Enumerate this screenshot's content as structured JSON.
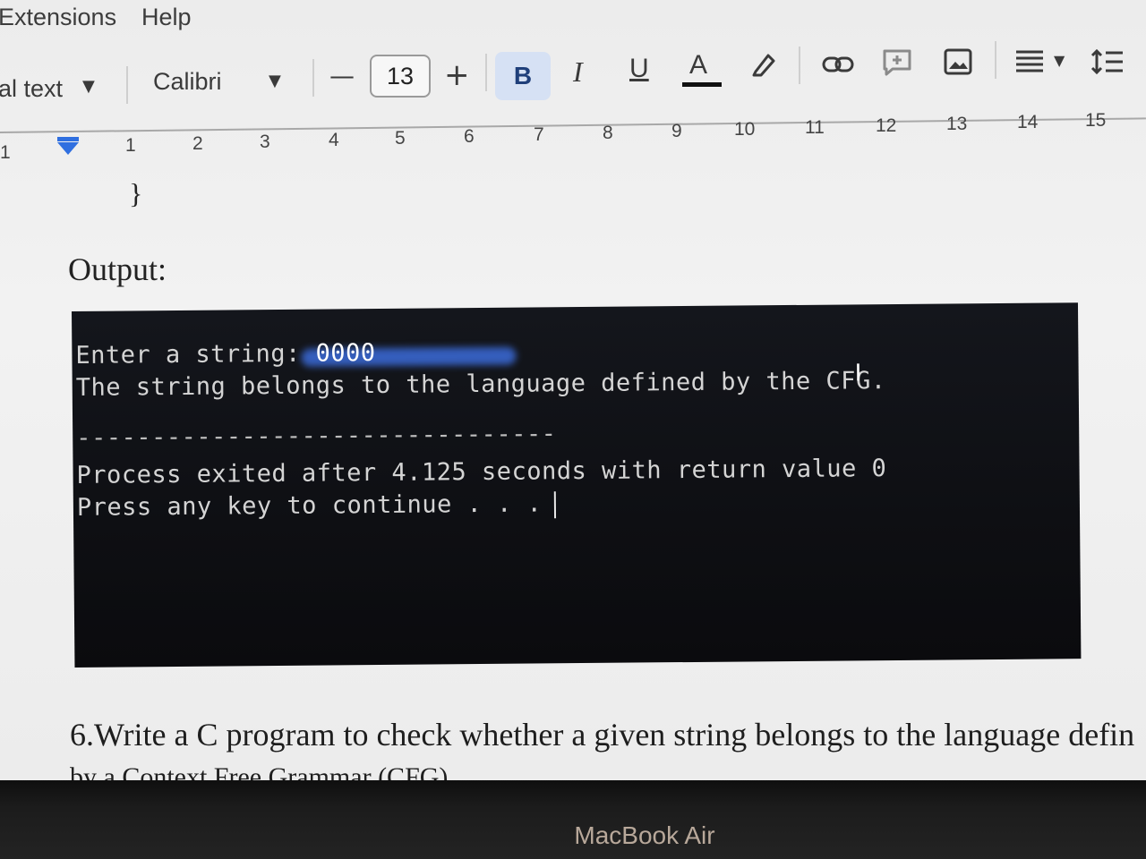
{
  "menu": {
    "items": [
      "Extensions",
      "Help"
    ]
  },
  "toolbar": {
    "style_label": "al text",
    "font_family": "Calibri",
    "font_size": "13",
    "decrease_symbol": "—",
    "increase_symbol": "+",
    "bold_label": "B",
    "italic_label": "I",
    "underline_label": "U",
    "text_color_label": "A"
  },
  "ruler": {
    "numbers": [
      "1",
      "1",
      "2",
      "3",
      "4",
      "5",
      "6",
      "7",
      "8",
      "9",
      "10",
      "11",
      "12",
      "13",
      "14",
      "15"
    ]
  },
  "document": {
    "brace": "}",
    "output_heading": "Output:",
    "question": "6.Write a C program to check whether a given string belongs to the language defin",
    "question_cut": "by a Context Free Grammar (CFG)"
  },
  "terminal": {
    "line1_prefix": "Enter a string: ",
    "line1_input": "0000",
    "line2": "The string belongs to the language defined by the CFG.",
    "separator": "--------------------------------",
    "line3": "Process exited after 4.125 seconds with return value 0",
    "line4": "Press any key to continue . . ."
  },
  "bezel": {
    "brand": "MacBook Air"
  },
  "colors": {
    "accent": "#2f6fe0",
    "bold_active_bg": "#d6e1f4",
    "terminal_bg": "#0e0f13",
    "terminal_text": "#d4d4d4"
  }
}
